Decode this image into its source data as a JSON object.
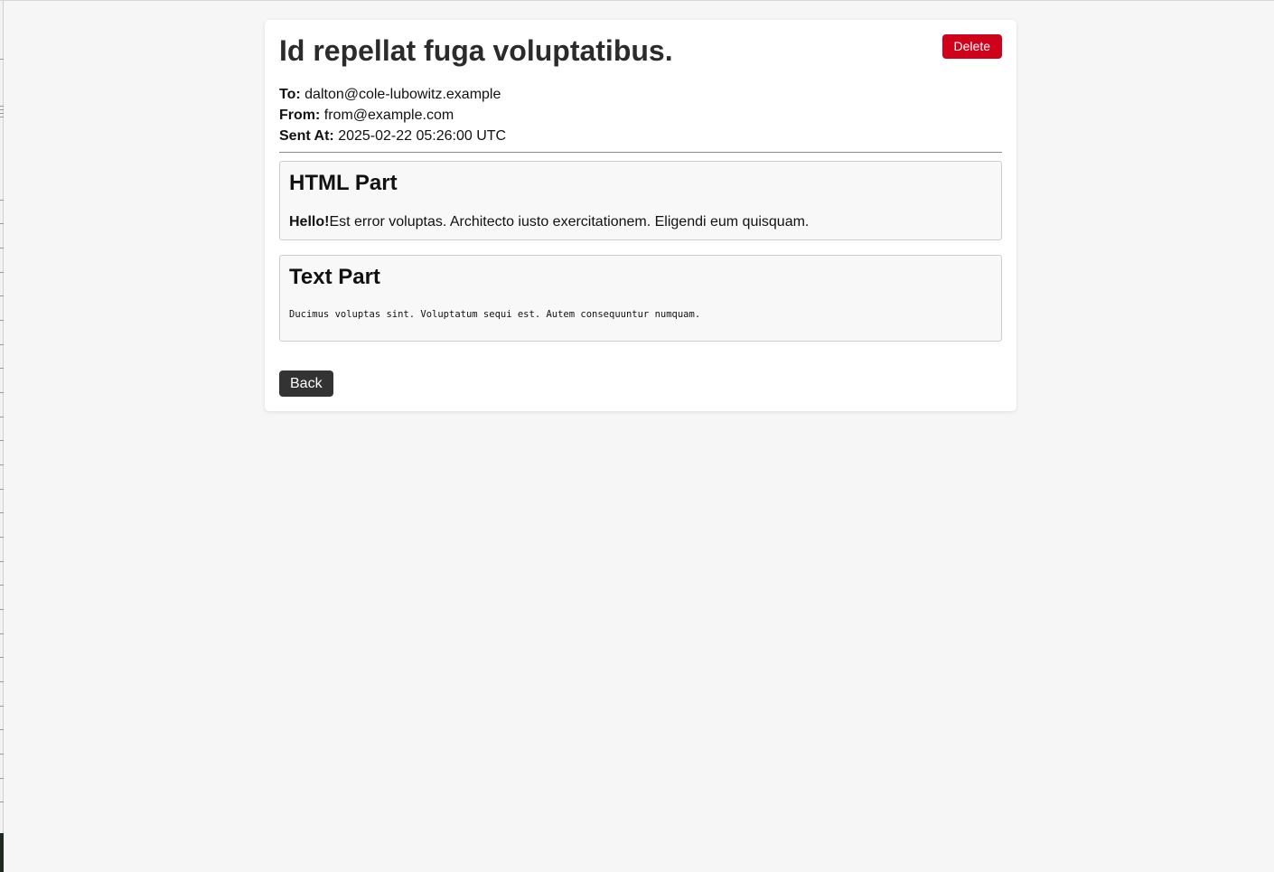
{
  "email": {
    "subject": "Id repellat fuga voluptatibus.",
    "delete_label": "Delete",
    "to_label": "To:",
    "to_value": "dalton@cole-lubowitz.example",
    "from_label": "From:",
    "from_value": "from@example.com",
    "sent_label": "Sent At:",
    "sent_value": "2025-02-22 05:26:00 UTC"
  },
  "html_part": {
    "heading": "HTML Part",
    "greeting": "Hello!",
    "body": "Est error voluptas. Architecto iusto exercitationem. Eligendi eum quisquam."
  },
  "text_part": {
    "heading": "Text Part",
    "body": "Ducimus voluptas sint. Voluptatum sequi est. Autem consequuntur numquam."
  },
  "actions": {
    "back_label": "Back"
  },
  "colors": {
    "delete": "#d0021b",
    "back": "#333333",
    "background": "#f6f6f6"
  }
}
